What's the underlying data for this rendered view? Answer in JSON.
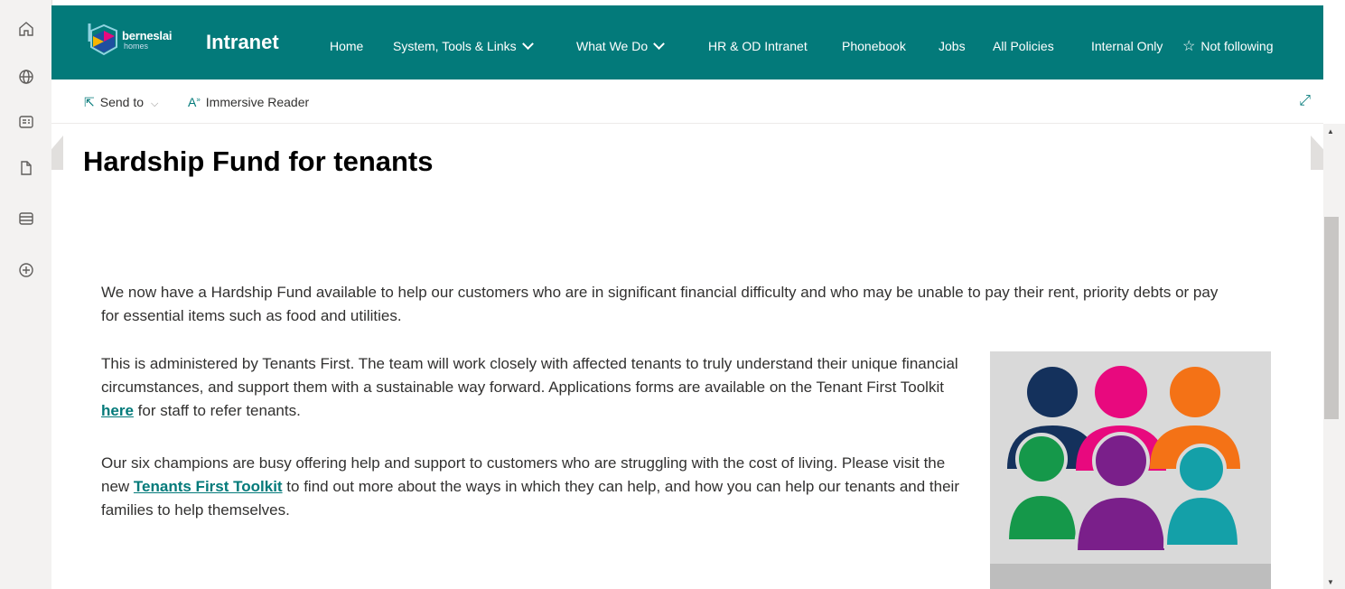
{
  "rail": {
    "items": [
      {
        "icon": "home-icon"
      },
      {
        "icon": "globe-icon"
      },
      {
        "icon": "news-icon"
      },
      {
        "icon": "document-icon"
      },
      {
        "icon": "list-icon"
      },
      {
        "icon": "add-circle-icon"
      }
    ]
  },
  "header": {
    "logo_name": "berneslai",
    "logo_sub": "homes",
    "site_title": "Intranet",
    "nav": [
      {
        "label": "Home",
        "dropdown": false
      },
      {
        "label": "System, Tools & Links",
        "dropdown": true
      },
      {
        "label": "What We Do",
        "dropdown": true
      },
      {
        "label": "HR & OD Intranet",
        "dropdown": false
      },
      {
        "label": "Phonebook",
        "dropdown": false
      },
      {
        "label": "Jobs",
        "dropdown": false
      },
      {
        "label": "All Policies",
        "dropdown": false
      },
      {
        "label": "Internal Only",
        "dropdown": false
      }
    ],
    "follow_label": "Not following",
    "brand_color": "#037a7a"
  },
  "command_bar": {
    "send_to": "Send to",
    "immersive_reader": "Immersive Reader"
  },
  "page": {
    "title": "Hardship Fund for tenants",
    "para1": "We now have a Hardship Fund available to help our customers who are in significant financial difficulty and who may be unable to pay their rent, priority debts or pay for essential items such as food and utilities.",
    "para2_before": "This is administered by Tenants First. The team will work closely with affected tenants to truly understand their unique financial circumstances, and support them with a sustainable way forward. Applications forms are available on the Tenant First Toolkit ",
    "para2_link": "here",
    "para2_after": " for staff to refer tenants.",
    "para3_before": "Our six champions are busy offering help and support to customers who are struggling with the cost of living. Please visit the new ",
    "para3_link": "Tenants First Toolkit",
    "para3_after": " to find out more about the ways in which they can help, and how you can help our tenants and their families to help themselves."
  },
  "illustration": {
    "colors": [
      "#14315c",
      "#e8097e",
      "#f47216",
      "#15984a",
      "#7a1f8a",
      "#14a0a8"
    ]
  }
}
